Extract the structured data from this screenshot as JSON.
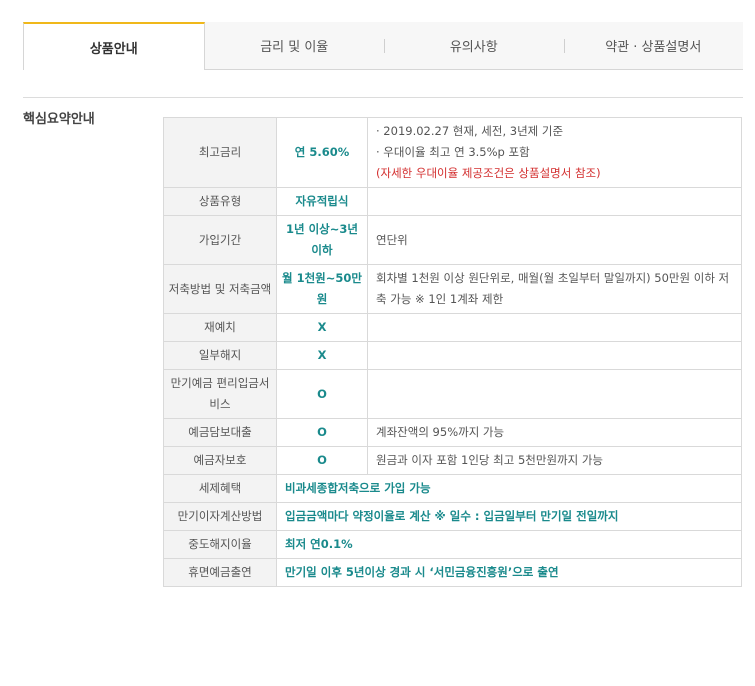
{
  "tabs": [
    {
      "label": "상품안내",
      "active": true
    },
    {
      "label": "금리 및 이율",
      "active": false
    },
    {
      "label": "유의사항",
      "active": false
    },
    {
      "label": "약관 · 상품설명서",
      "active": false
    }
  ],
  "section_title": "핵심요약안내",
  "rows": {
    "max_rate": {
      "label": "최고금리",
      "value": "연 5.60%",
      "notes": [
        "· 2019.02.27 현재, 세전, 3년제 기준",
        "· 우대이율 최고 연 3.5%p 포함"
      ],
      "note_red": "(자세한 우대이율 제공조건은 상품설명서 참조)"
    },
    "product_type": {
      "label": "상품유형",
      "value": "자유적립식",
      "desc": ""
    },
    "join_period": {
      "label": "가입기간",
      "value": "1년 이상~3년 이하",
      "desc": "연단위"
    },
    "saving_method": {
      "label": "저축방법 및 저축금액",
      "value": "월 1천원~50만원",
      "desc": "회차별 1천원 이상 원단위로, 매월(월 초일부터 말일까지) 50만원 이하 저축 가능 ※ 1인 1계좌 제한"
    },
    "redeposit": {
      "label": "재예치",
      "value": "X",
      "desc": ""
    },
    "partial_withdraw": {
      "label": "일부해지",
      "value": "X",
      "desc": ""
    },
    "maturity_service": {
      "label": "만기예금 편리입금서비스",
      "value": "O",
      "desc": ""
    },
    "deposit_loan": {
      "label": "예금담보대출",
      "value": "O",
      "desc": "계좌잔액의 95%까지 가능"
    },
    "depositor_protection": {
      "label": "예금자보호",
      "value": "O",
      "desc": "원금과 이자 포함 1인당 최고 5천만원까지 가능"
    },
    "tax_benefit": {
      "label": "세제혜택",
      "value": "비과세종합저축으로 가입 가능"
    },
    "maturity_interest": {
      "label": "만기이자계산방법",
      "value": "입금금액마다 약정이율로 계산 ※ 일수 : 입금일부터 만기일 전일까지"
    },
    "early_termination": {
      "label": "중도해지이율",
      "value": "최저 연0.1%"
    },
    "dormant": {
      "label": "휴면예금출연",
      "value": "만기일 이후 5년이상 경과 시 ‘서민금융진흥원’으로 출연"
    }
  },
  "colors": {
    "accent_tab": "#f0b81a",
    "value_teal": "#1a8a8c",
    "note_red": "#d32f2f"
  }
}
